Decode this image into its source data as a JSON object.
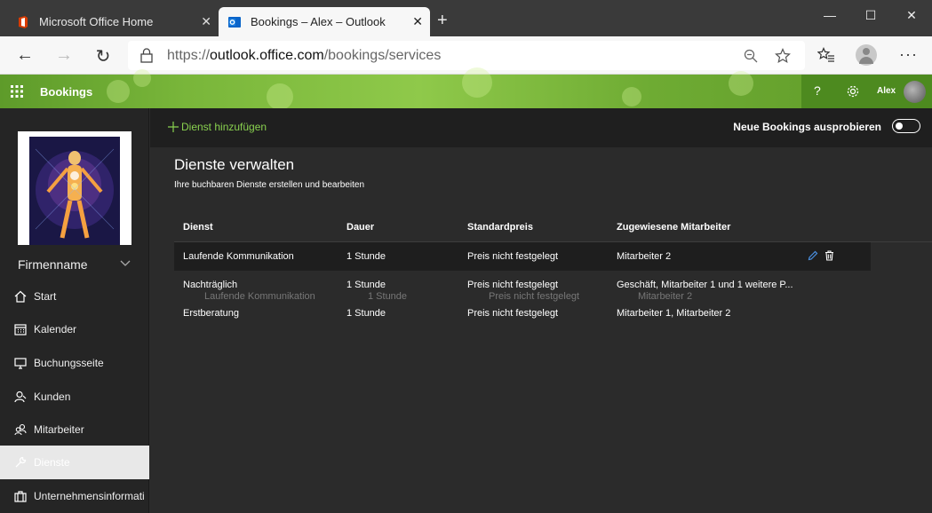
{
  "browser": {
    "tabs": [
      {
        "title": "Microsoft Office Home",
        "active": false
      },
      {
        "title": "Bookings – Alex – Outlook",
        "active": true
      }
    ],
    "url_prefix": "https://",
    "url_host": "outlook.office.com",
    "url_path": "/bookings/services"
  },
  "app": {
    "name": "Bookings",
    "user": "Alex",
    "accent": "#6ab02e"
  },
  "sidebar": {
    "business_name": "Firmenname",
    "items": [
      {
        "label": "Start",
        "icon": "home-icon"
      },
      {
        "label": "Kalender",
        "icon": "calendar-icon"
      },
      {
        "label": "Buchungsseite",
        "icon": "monitor-icon"
      },
      {
        "label": "Kunden",
        "icon": "person-icon"
      },
      {
        "label": "Mitarbeiter",
        "icon": "people-icon"
      },
      {
        "label": "Dienste",
        "icon": "wrench-icon",
        "active": true
      },
      {
        "label": "Unternehmensinformati",
        "icon": "briefcase-icon"
      }
    ]
  },
  "commandbar": {
    "add_label": "Dienst hinzufügen",
    "try_new_label": "Neue Bookings ausprobieren"
  },
  "main": {
    "title": "Dienste verwalten",
    "subtitle": "Ihre buchbaren Dienste erstellen und bearbeiten",
    "columns": [
      "Dienst",
      "Dauer",
      "Standardpreis",
      "Zugewiesene Mitarbeiter"
    ],
    "rows": [
      [
        "Laufende Kommunikation",
        "1 Stunde",
        "Preis nicht festgelegt",
        "Mitarbeiter 2"
      ],
      [
        "Nachträglich",
        "1 Stunde",
        "Preis nicht festgelegt",
        "Geschäft, Mitarbeiter 1 und 1 weitere P..."
      ],
      [
        "Erstberatung",
        "1 Stunde",
        "Preis nicht festgelegt",
        "Mitarbeiter 1, Mitarbeiter 2"
      ]
    ],
    "drag_ghost": [
      "Laufende Kommunikation",
      "1 Stunde",
      "Preis nicht festgelegt",
      "Mitarbeiter 2"
    ]
  }
}
